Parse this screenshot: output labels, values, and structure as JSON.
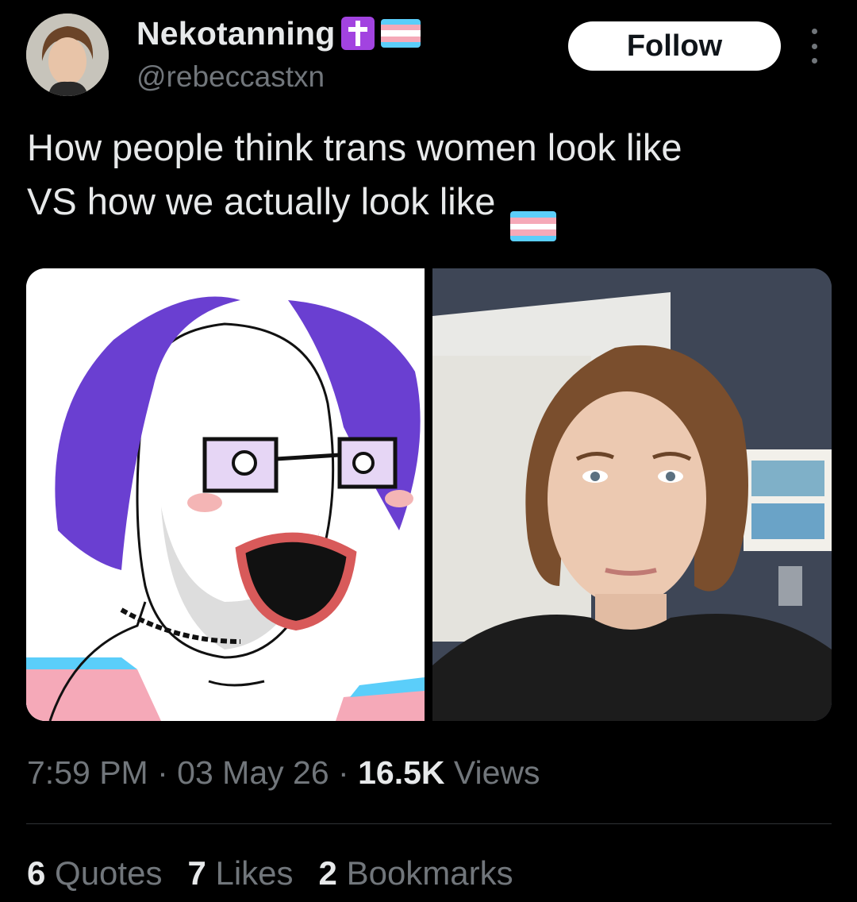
{
  "author": {
    "display_name": "Nekotanning",
    "handle": "@rebeccastxn",
    "badges": [
      "latin-cross-emoji",
      "transgender-flag-emoji"
    ]
  },
  "follow_label": "Follow",
  "more_icon": "more-vertical-icon",
  "tweet": {
    "line1": "How people think trans women look like",
    "line2": "VS how we actually look like",
    "trailing_emoji": "transgender-flag-emoji"
  },
  "media": [
    {
      "name": "cartoon-meme-drawing"
    },
    {
      "name": "selfie-photo"
    }
  ],
  "meta": {
    "time": "7:59 PM",
    "separator": "·",
    "date": "03 May 26",
    "views_count": "16.5K",
    "views_label": "Views"
  },
  "stats": [
    {
      "count": "6",
      "label": "Quotes"
    },
    {
      "count": "7",
      "label": "Likes"
    },
    {
      "count": "2",
      "label": "Bookmarks"
    }
  ],
  "colors": {
    "background": "#000000",
    "text_primary": "#e7e9ea",
    "text_secondary": "#71767b",
    "divider": "#2f3336",
    "cross_badge": "#a243e0",
    "flag_blue": "#5bcefa",
    "flag_pink": "#f5a9b8",
    "flag_white": "#ffffff"
  }
}
